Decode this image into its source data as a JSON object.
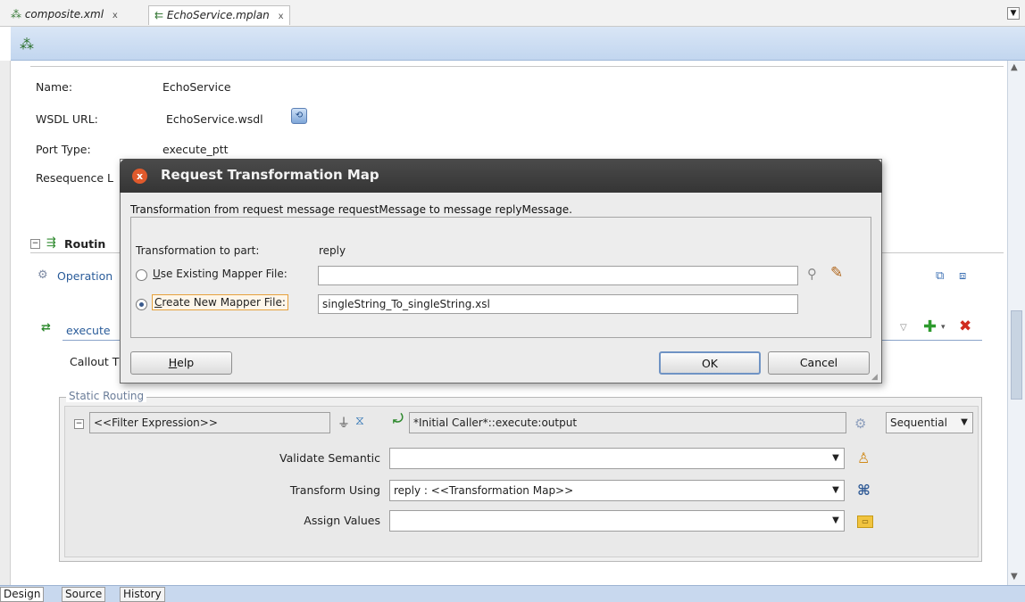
{
  "tabs": [
    {
      "label": "composite.xml",
      "close": "x"
    },
    {
      "label": "EchoService.mplan",
      "close": "x"
    }
  ],
  "form": {
    "name_label": "Name:",
    "name_value": "EchoService",
    "wsdl_label": "WSDL URL:",
    "wsdl_value": "EchoService.wsdl",
    "port_label": "Port Type:",
    "port_value": "execute_ptt",
    "reseq_label": "Resequence L"
  },
  "routing": {
    "header": "Routin",
    "operation": "Operation",
    "execute": "execute",
    "callout": "Callout T"
  },
  "static_routing": {
    "legend": "Static Routing",
    "filter": "<<Filter Expression>>",
    "target": "*Initial Caller*::execute:output",
    "mode": "Sequential",
    "validate_label": "Validate Semantic",
    "validate_value": "",
    "transform_label": "Transform Using",
    "transform_value": "reply : <<Transformation Map>>",
    "assign_label": "Assign Values",
    "assign_value": ""
  },
  "dialog": {
    "title": "Request Transformation Map",
    "description": "Transformation from request message requestMessage to message replyMessage.",
    "part_label": "Transformation to part:",
    "part_value": "reply",
    "existing_label_u": "U",
    "existing_label_rest": "se Existing Mapper File:",
    "existing_value": "",
    "create_label_u": "C",
    "create_label_rest": "reate New Mapper File:",
    "create_value": "singleString_To_singleString.xsl",
    "help_u": "H",
    "help_rest": "elp",
    "ok": "OK",
    "cancel": "Cancel"
  },
  "bottom_tabs": [
    "Design",
    "Source",
    "History"
  ],
  "icons": {
    "close": "x",
    "dropdown": "▼",
    "collapse": "⊟"
  },
  "colors": {
    "dialog_title_bg": "#3d3d3d",
    "close_button": "#e05a2c",
    "toolbar_bg": "#c9dbf1"
  }
}
